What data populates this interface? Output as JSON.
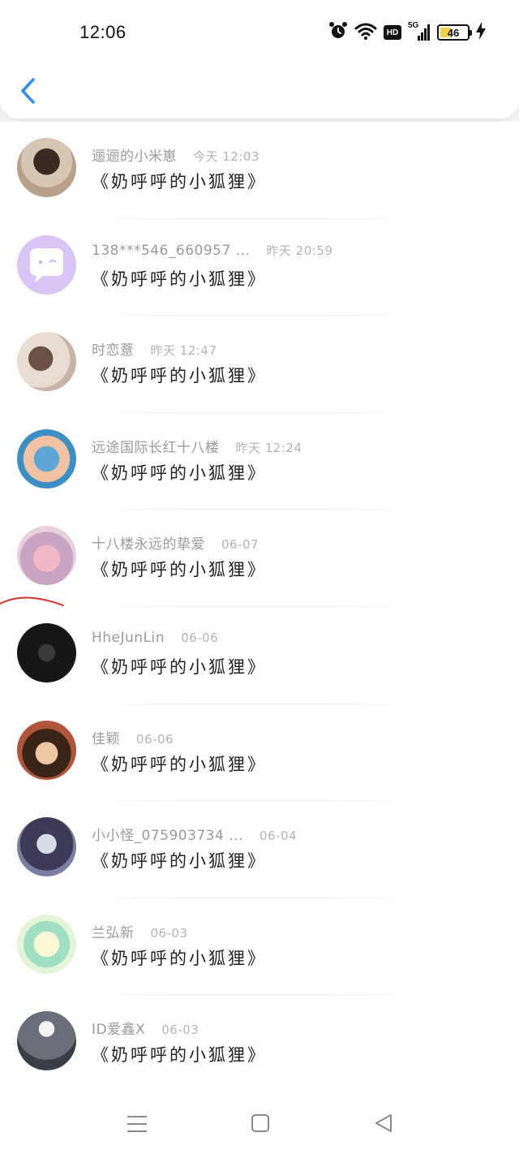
{
  "status_bar": {
    "time": "12:06",
    "hd": "HD",
    "network": "5G",
    "battery": "46",
    "battery_level": 0.46,
    "icons": [
      "alarm-icon",
      "wifi-icon",
      "hd-icon",
      "signal-icon",
      "battery-icon",
      "charging-icon"
    ]
  },
  "header": {
    "back_icon": "chevron-left-icon",
    "accent": "#2f8df5"
  },
  "messages": [
    {
      "name": "逦逦的小米崽",
      "date": "今天 12:03",
      "text": "《奶呼呼的小狐狸》"
    },
    {
      "name": "138***546_660957 ...",
      "date": "昨天 20:59",
      "text": "《奶呼呼的小狐狸》"
    },
    {
      "name": "时恋薏",
      "date": "昨天 12:47",
      "text": "《奶呼呼的小狐狸》"
    },
    {
      "name": "远途国际长红十八楼",
      "date": "昨天 12:24",
      "text": "《奶呼呼的小狐狸》"
    },
    {
      "name": "十八楼永远的挚爱",
      "date": "06-07",
      "text": "《奶呼呼的小狐狸》"
    },
    {
      "name": "HheJunLin",
      "date": "06-06",
      "text": "《奶呼呼的小狐狸》"
    },
    {
      "name": "佳颖",
      "date": "06-06",
      "text": "《奶呼呼的小狐狸》"
    },
    {
      "name": "小小怪_075903734 ...",
      "date": "06-04",
      "text": "《奶呼呼的小狐狸》"
    },
    {
      "name": "兰弘新",
      "date": "06-03",
      "text": "《奶呼呼的小狐狸》"
    },
    {
      "name": "ID爱鑫X",
      "date": "06-03",
      "text": "《奶呼呼的小狐狸》"
    }
  ],
  "nav_bar": {
    "icons": [
      "menu-icon",
      "home-icon",
      "back-triangle-icon"
    ]
  }
}
